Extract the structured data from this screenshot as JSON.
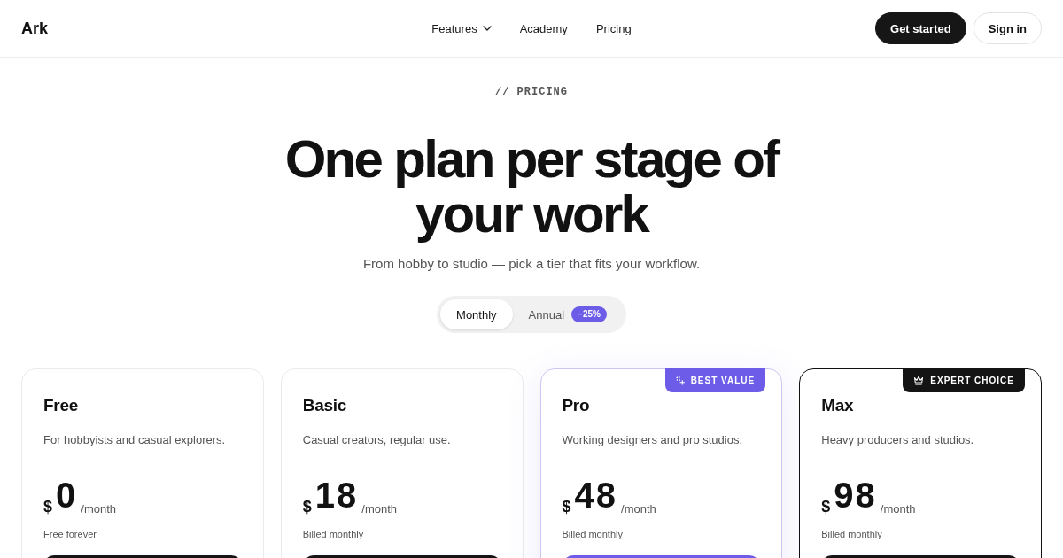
{
  "nav": {
    "logo": "Ark",
    "links": [
      {
        "label": "Features",
        "dropdown": true
      },
      {
        "label": "Academy",
        "dropdown": false
      },
      {
        "label": "Pricing",
        "dropdown": false
      }
    ],
    "actions": [
      {
        "label": "Get started",
        "kind": "primary"
      },
      {
        "label": "Sign in",
        "kind": "secondary"
      }
    ]
  },
  "hero": {
    "eyebrow": "// PRICING",
    "title": "One plan per stage of your work",
    "subtitle": "From hobby to studio — pick a tier that fits your workflow."
  },
  "billing_toggle": [
    {
      "label": "Monthly",
      "selected": true
    },
    {
      "label": "Annual",
      "selected": false,
      "badge": "−25%"
    }
  ],
  "plans": [
    {
      "name": "Free",
      "kind": "plain",
      "description": "For hobbyists and casual explorers.",
      "currency": "$",
      "price": "0",
      "period": "/month",
      "note": "Free forever"
    },
    {
      "name": "Basic",
      "kind": "plain",
      "description": "Casual creators, regular use.",
      "currency": "$",
      "price": "18",
      "period": "/month",
      "note": "Billed monthly"
    },
    {
      "name": "Pro",
      "kind": "accent",
      "badge": "BEST VALUE",
      "description": "Working designers and pro studios.",
      "currency": "$",
      "price": "48",
      "period": "/month",
      "note": "Billed monthly"
    },
    {
      "name": "Max",
      "kind": "dark",
      "badge": "EXPERT CHOICE",
      "description": "Heavy producers and studios.",
      "currency": "$",
      "price": "98",
      "period": "/month",
      "note": "Billed monthly"
    }
  ]
}
